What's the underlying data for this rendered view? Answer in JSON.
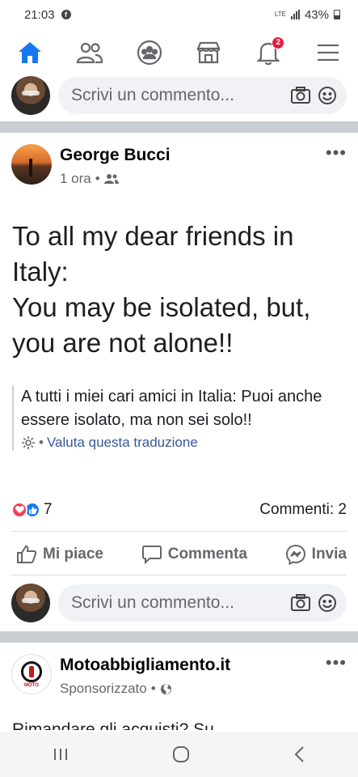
{
  "status_bar": {
    "time": "21:03",
    "network": "LTE",
    "battery": "43%"
  },
  "nav": {
    "notifications_badge": "2"
  },
  "comment_box": {
    "placeholder": "Scrivi un commento..."
  },
  "post": {
    "author": "George Bucci",
    "time": "1 ora",
    "text": "To all my dear friends in Italy:\nYou may be isolated, but, you are not alone!!",
    "translation": "A tutti i miei cari amici in Italia: Puoi anche essere isolato, ma non sei solo!!",
    "rate_translation": "Valuta questa traduzione",
    "reaction_count": "7",
    "comments": "Commenti: 2",
    "actions": {
      "like": "Mi piace",
      "comment": "Commenta",
      "share": "Invia"
    }
  },
  "sponsored_post": {
    "author": "Motoabbigliamento.it",
    "label": "Sponsorizzato",
    "logo_text": "MOTO",
    "text_preview": "Rimandare gli acquisti? Su"
  },
  "colors": {
    "accent": "#1877f2",
    "separator": "#c9ccd1",
    "badge": "#e41e3f"
  }
}
